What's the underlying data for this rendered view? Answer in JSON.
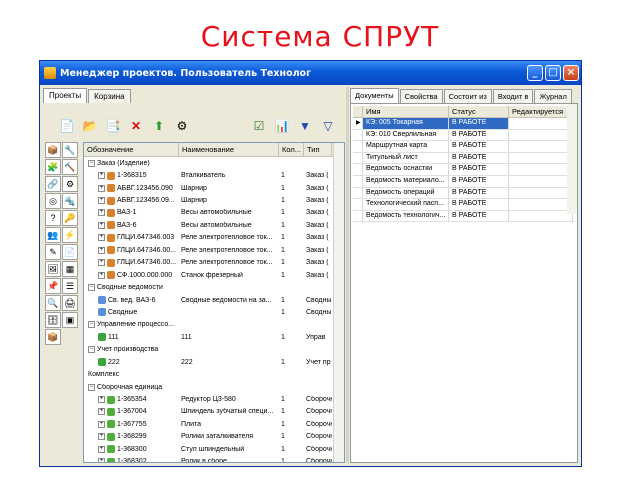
{
  "slide_title": "Система СПРУТ",
  "window": {
    "title": "Менеджер проектов. Пользователь Технолог",
    "buttons": {
      "minimize": "_",
      "maximize": "□",
      "close": "×"
    }
  },
  "left": {
    "tabs": [
      "Проекты",
      "Корзина"
    ],
    "columns": [
      "Обозначение",
      "Наименование",
      "Кол...",
      "Тип"
    ],
    "rows": [
      {
        "level": 0,
        "exp": "−",
        "code": "Заказ (Изделие)",
        "name": "",
        "qty": "",
        "type": "",
        "icon": "folder"
      },
      {
        "level": 1,
        "exp": "+",
        "code": "1-368315",
        "name": "Вталкиватель",
        "qty": "1",
        "type": "Заказ (",
        "icon": "part"
      },
      {
        "level": 1,
        "exp": "+",
        "code": "АБВГ.123456.090",
        "name": "Шарнир",
        "qty": "1",
        "type": "Заказ (",
        "icon": "part"
      },
      {
        "level": 1,
        "exp": "+",
        "code": "АБВГ.123456.09...",
        "name": "Шарнир",
        "qty": "1",
        "type": "Заказ (",
        "icon": "part"
      },
      {
        "level": 1,
        "exp": "+",
        "code": "ВАЗ-1",
        "name": "Весы автомобильные",
        "qty": "1",
        "type": "Заказ (",
        "icon": "part"
      },
      {
        "level": 1,
        "exp": "+",
        "code": "ВАЗ-6",
        "name": "Весы автомобильные",
        "qty": "1",
        "type": "Заказ (",
        "icon": "part"
      },
      {
        "level": 1,
        "exp": "+",
        "code": "ГЛЦИ.647346.003",
        "name": "Реле электротепловое ток...",
        "qty": "1",
        "type": "Заказ (",
        "icon": "part"
      },
      {
        "level": 1,
        "exp": "+",
        "code": "ГЛЦИ.647346.00...",
        "name": "Реле электротепловое ток...",
        "qty": "1",
        "type": "Заказ (",
        "icon": "part"
      },
      {
        "level": 1,
        "exp": "+",
        "code": "ГЛЦИ.647346.00...",
        "name": "Реле электротепловое ток...",
        "qty": "1",
        "type": "Заказ (",
        "icon": "part"
      },
      {
        "level": 1,
        "exp": "+",
        "code": "СФ.1000.000.000",
        "name": "Станок фрезерный",
        "qty": "1",
        "type": "Заказ (",
        "icon": "part"
      },
      {
        "level": 0,
        "exp": "−",
        "code": "Сводные ведомости",
        "name": "",
        "qty": "",
        "type": "",
        "icon": "folder"
      },
      {
        "level": 1,
        "exp": "",
        "code": "Св. вед. ВАЗ-6",
        "name": "Сводные ведомости на за...",
        "qty": "1",
        "type": "Сводны",
        "icon": "sheet"
      },
      {
        "level": 1,
        "exp": "",
        "code": "Сводные",
        "name": "",
        "qty": "1",
        "type": "Сводны",
        "icon": "sheet"
      },
      {
        "level": 0,
        "exp": "−",
        "code": "Управление процессо...",
        "name": "",
        "qty": "",
        "type": "",
        "icon": "folder"
      },
      {
        "level": 1,
        "exp": "",
        "code": "111",
        "name": "111",
        "qty": "1",
        "type": "Управ",
        "icon": "proc"
      },
      {
        "level": 0,
        "exp": "−",
        "code": "Учет производства",
        "name": "",
        "qty": "",
        "type": "",
        "icon": "folder"
      },
      {
        "level": 1,
        "exp": "",
        "code": "222",
        "name": "222",
        "qty": "1",
        "type": "Учет пр",
        "icon": "proc"
      },
      {
        "level": 0,
        "exp": "",
        "code": "Комплекс",
        "name": "",
        "qty": "",
        "type": "",
        "icon": "none"
      },
      {
        "level": 0,
        "exp": "−",
        "code": "Сборочная единица",
        "name": "",
        "qty": "",
        "type": "",
        "icon": "folder"
      },
      {
        "level": 1,
        "exp": "+",
        "code": "1-365354",
        "name": "Редуктор Ц3-580",
        "qty": "1",
        "type": "Сборочн",
        "icon": "asm"
      },
      {
        "level": 1,
        "exp": "+",
        "code": "1-367004",
        "name": "Шпиндель зубчатый специ...",
        "qty": "1",
        "type": "Сборочн",
        "icon": "asm"
      },
      {
        "level": 1,
        "exp": "+",
        "code": "1-367755",
        "name": "Плита",
        "qty": "1",
        "type": "Сборочн",
        "icon": "asm"
      },
      {
        "level": 1,
        "exp": "+",
        "code": "1-368299",
        "name": "Ролики заталкивателя",
        "qty": "1",
        "type": "Сборочн",
        "icon": "asm"
      },
      {
        "level": 1,
        "exp": "+",
        "code": "1-368300",
        "name": "Стул шпиндельный",
        "qty": "1",
        "type": "Сборочн",
        "icon": "asm"
      },
      {
        "level": 1,
        "exp": "+",
        "code": "1-368302",
        "name": "Ролик в сборе",
        "qty": "1",
        "type": "Сборочн",
        "icon": "asm"
      }
    ]
  },
  "right": {
    "tabs": [
      "Документы",
      "Свойства",
      "Состоит из",
      "Входит в",
      "Журнал"
    ],
    "columns": [
      "Имя",
      "Статус",
      "Редактируется"
    ],
    "rows": [
      {
        "name": "КЭ: 005 Токарная",
        "status": "В РАБОТЕ",
        "selected": true
      },
      {
        "name": "КЭ: 010 Сверлильная",
        "status": "В РАБОТЕ",
        "selected": false
      },
      {
        "name": "Маршрутная карта",
        "status": "В РАБОТЕ",
        "selected": false
      },
      {
        "name": "Титульный лист",
        "status": "В РАБОТЕ",
        "selected": false
      },
      {
        "name": "Ведомость оснастки",
        "status": "В РАБОТЕ",
        "selected": false
      },
      {
        "name": "Ведомость материало...",
        "status": "В РАБОТЕ",
        "selected": false
      },
      {
        "name": "Ведомость операций",
        "status": "В РАБОТЕ",
        "selected": false
      },
      {
        "name": "Технологический пасп...",
        "status": "В РАБОТЕ",
        "selected": false
      },
      {
        "name": "Ведомость технологич...",
        "status": "В РАБОТЕ",
        "selected": false
      }
    ]
  },
  "colors": {
    "title_red": "#e8101a",
    "selection": "#316ac5",
    "titlebar": "#0a5ad8"
  }
}
